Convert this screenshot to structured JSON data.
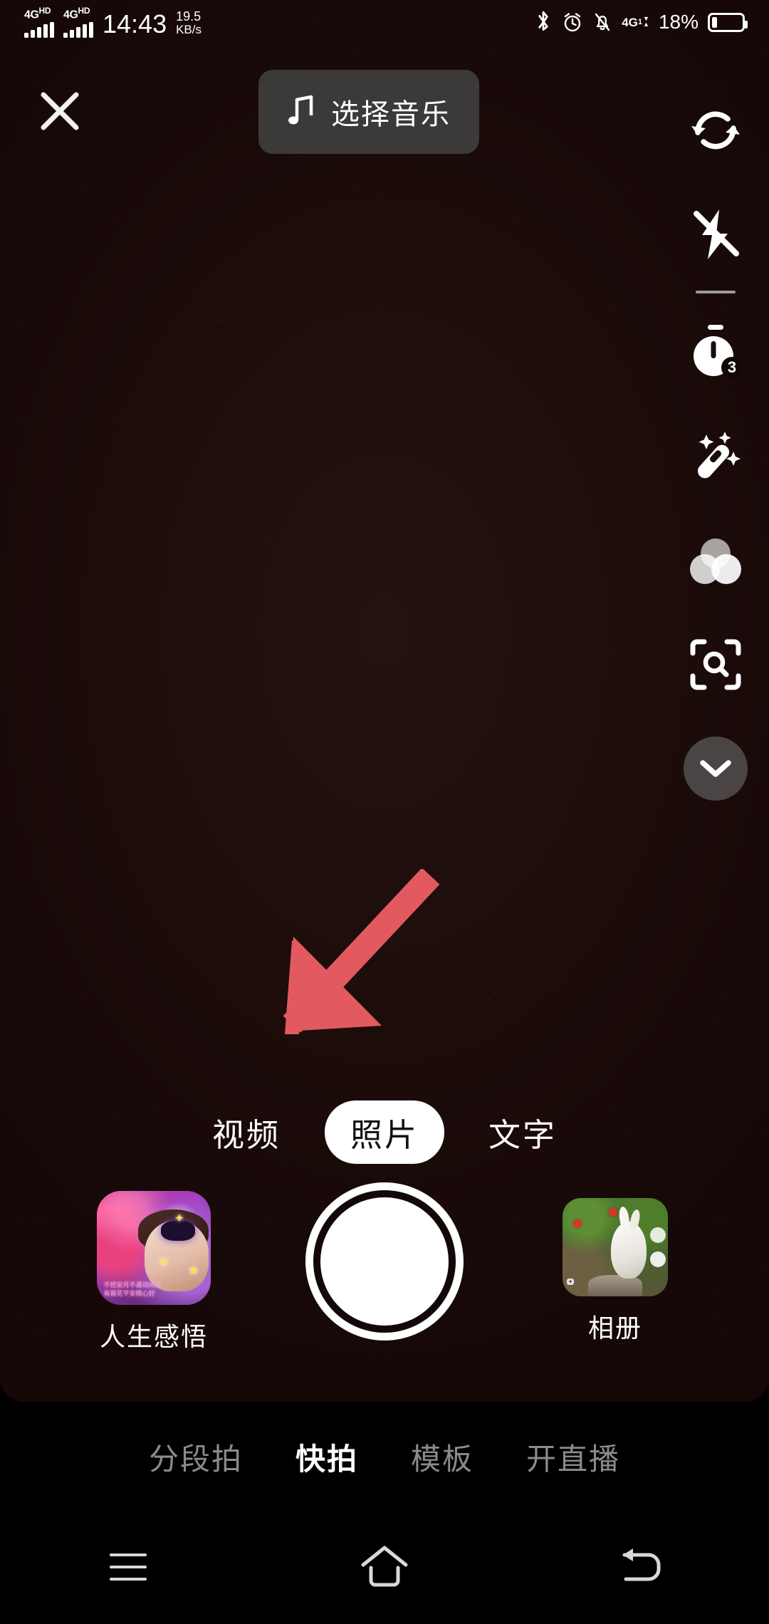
{
  "status_bar": {
    "sim1_network": "4G",
    "sim1_network_sup": "HD",
    "sim2_network": "4G",
    "sim2_network_sup": "HD",
    "time": "14:43",
    "net_speed_value": "19.5",
    "net_speed_unit": "KB/s",
    "bluetooth_icon": "bluetooth-icon",
    "alarm_icon": "alarm-icon",
    "mute_icon": "bell-off-icon",
    "data_label": "4G",
    "data_sub": "1",
    "battery_percent": "18%",
    "battery_level": 18
  },
  "top_bar": {
    "close_label": "✕",
    "close_name": "close-icon",
    "music_button_label": "选择音乐",
    "music_icon": "music-note-icon"
  },
  "right_rail": {
    "items": [
      {
        "name": "flip-camera-icon",
        "label": "翻转"
      },
      {
        "name": "flash-off-icon",
        "label": "闪光灯关"
      },
      {
        "name": "timer-icon",
        "label": "定时",
        "badge": "3"
      },
      {
        "name": "beauty-wand-icon",
        "label": "美化"
      },
      {
        "name": "filter-icon",
        "label": "滤镜"
      },
      {
        "name": "scan-icon",
        "label": "扫一扫"
      }
    ],
    "collapse_icon": "chevron-down-icon"
  },
  "annotation": {
    "arrow_name": "red-arrow-annotation",
    "arrow_color": "#E25A60",
    "points_to": "视频"
  },
  "mode_tabs": {
    "selected": "照片",
    "items": [
      {
        "label": "视频",
        "selected": false
      },
      {
        "label": "照片",
        "selected": true
      },
      {
        "label": "文字",
        "selected": false
      }
    ]
  },
  "capture_row": {
    "effect": {
      "label": "人生感悟",
      "thumb_name": "effect-thumbnail"
    },
    "shutter": {
      "name": "shutter-button"
    },
    "album": {
      "label": "相册",
      "thumb_name": "album-thumbnail"
    },
    "effect_thumb_text": "不挖安月不遇动闹只有握花平安精心好"
  },
  "mode_bar": {
    "active": "快拍",
    "items": [
      {
        "label": "分段拍",
        "active": false
      },
      {
        "label": "快拍",
        "active": true
      },
      {
        "label": "模板",
        "active": false
      },
      {
        "label": "开直播",
        "active": false
      }
    ]
  },
  "nav_bar": {
    "recents": "recents-icon",
    "home": "home-icon",
    "back": "back-icon"
  },
  "colors": {
    "viewfinder_bg": "#1D0D0B",
    "accent_red": "#E25A60",
    "pill_bg": "#464646",
    "inactive_text": "#8B8B8B"
  }
}
